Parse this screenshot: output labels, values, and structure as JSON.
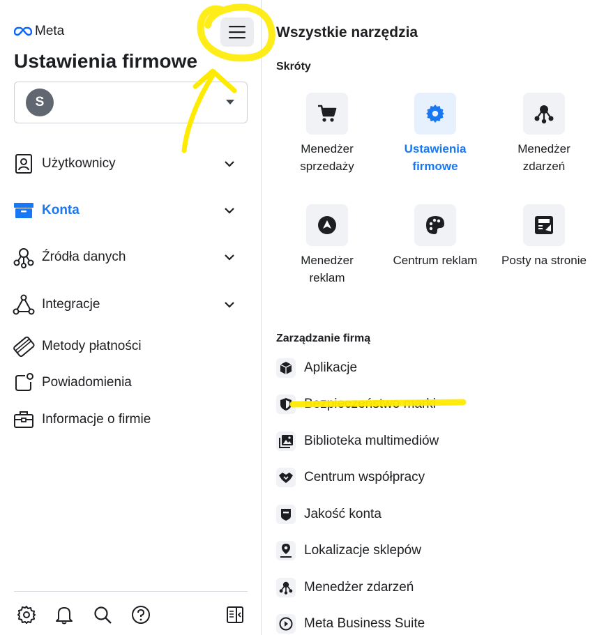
{
  "left": {
    "logo_text": "Meta",
    "title": "Ustawienia firmowe",
    "account": {
      "avatar_letter": "S"
    },
    "nav": [
      {
        "label": "Użytkownicy",
        "icon": "user-badge-icon",
        "has_chevron": true,
        "active": false
      },
      {
        "label": "Konta",
        "icon": "archive-box-icon",
        "has_chevron": true,
        "active": true
      },
      {
        "label": "Źródła danych",
        "icon": "data-sources-icon",
        "has_chevron": true,
        "active": false
      },
      {
        "label": "Integracje",
        "icon": "integrations-icon",
        "has_chevron": true,
        "active": false
      },
      {
        "label": "Metody płatności",
        "icon": "credit-card-icon",
        "has_chevron": false,
        "active": false
      },
      {
        "label": "Powiadomienia",
        "icon": "notification-icon",
        "has_chevron": false,
        "active": false
      },
      {
        "label": "Informacje o firmie",
        "icon": "briefcase-icon",
        "has_chevron": false,
        "active": false
      }
    ],
    "bottom_icons": [
      "settings-icon",
      "bell-icon",
      "search-icon",
      "help-icon",
      "collapse-panel-icon"
    ]
  },
  "right": {
    "title": "Wszystkie narzędzia",
    "shortcuts_title": "Skróty",
    "shortcuts": [
      {
        "label": "Menedżer sprzedaży",
        "icon": "cart-icon",
        "active": false
      },
      {
        "label": "Ustawienia firmowe",
        "icon": "gear-icon",
        "active": true
      },
      {
        "label": "Menedżer zdarzeń",
        "icon": "events-manager-icon",
        "active": false
      },
      {
        "label": "Menedżer reklam",
        "icon": "ads-manager-icon",
        "active": false
      },
      {
        "label": "Centrum reklam",
        "icon": "palette-icon",
        "active": false
      },
      {
        "label": "Posty na stronie",
        "icon": "page-posts-icon",
        "active": false
      }
    ],
    "management_title": "Zarządzanie firmą",
    "management": [
      {
        "label": "Aplikacje",
        "icon": "cube-icon"
      },
      {
        "label": "Bezpieczeństwo marki",
        "icon": "shield-icon"
      },
      {
        "label": "Biblioteka multimediów",
        "icon": "media-library-icon"
      },
      {
        "label": "Centrum współpracy",
        "icon": "handshake-icon"
      },
      {
        "label": "Jakość konta",
        "icon": "account-quality-icon"
      },
      {
        "label": "Lokalizacje sklepów",
        "icon": "map-pin-icon"
      },
      {
        "label": "Menedżer zdarzeń",
        "icon": "events-manager-icon"
      },
      {
        "label": "Meta Business Suite",
        "icon": "business-suite-icon"
      }
    ]
  },
  "colors": {
    "accent": "#1877f2",
    "highlight": "#ffeb00",
    "text": "#1c1e21",
    "icon_bg": "#f0f2f5"
  }
}
